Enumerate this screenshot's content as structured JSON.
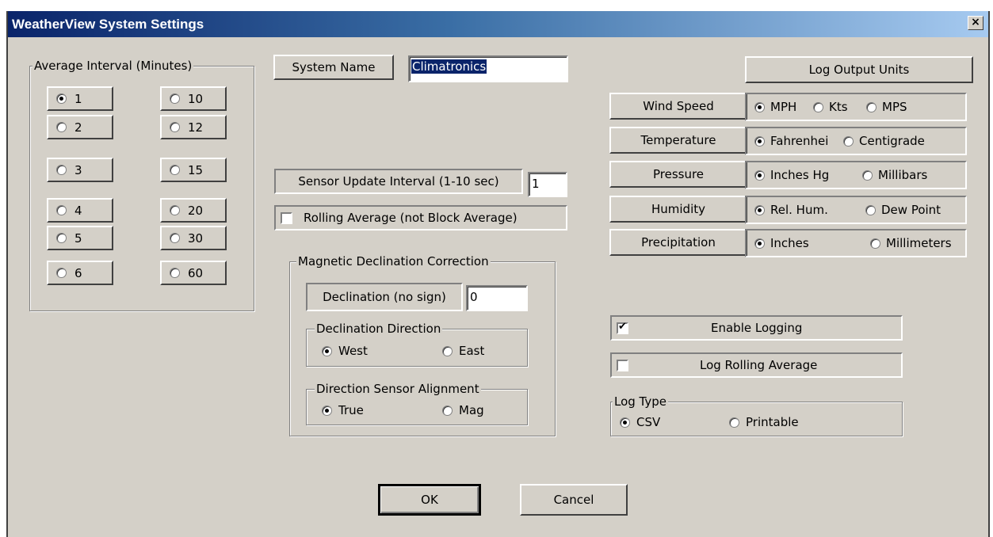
{
  "window": {
    "title": "WeatherView System Settings",
    "close": "×"
  },
  "avg_interval": {
    "legend": "Average Interval (Minutes)",
    "selected": "1",
    "options_left": [
      "1",
      "2",
      "3",
      "4",
      "5",
      "6"
    ],
    "options_right": [
      "10",
      "12",
      "15",
      "20",
      "30",
      "60"
    ]
  },
  "system_name": {
    "label": "System Name",
    "value": "Climatronics"
  },
  "sensor_update": {
    "label": "Sensor Update Interval (1-10 sec)",
    "value": "1"
  },
  "rolling_average": {
    "label": "Rolling Average (not Block Average)",
    "checked": false
  },
  "magnetic": {
    "legend": "Magnetic Declination Correction",
    "declination_label": "Declination (no sign)",
    "declination_value": "0",
    "direction": {
      "legend": "Declination Direction",
      "west": "West",
      "east": "East",
      "selected": "West"
    },
    "alignment": {
      "legend": "Direction Sensor Alignment",
      "true_label": "True",
      "mag": "Mag",
      "selected": "True"
    }
  },
  "log_units": {
    "header": "Log Output Units",
    "wind": {
      "label": "Wind Speed",
      "opt1": "MPH",
      "opt2": "Kts",
      "opt3": "MPS",
      "selected": "MPH"
    },
    "temperature": {
      "label": "Temperature",
      "opt1": "Fahrenhei",
      "opt2": "Centigrade",
      "selected": "Fahrenhei"
    },
    "pressure": {
      "label": "Pressure",
      "opt1": "Inches Hg",
      "opt2": "Millibars",
      "selected": "Inches Hg"
    },
    "humidity": {
      "label": "Humidity",
      "opt1": "Rel. Hum.",
      "opt2": "Dew Point",
      "selected": "Rel. Hum."
    },
    "precipitation": {
      "label": "Precipitation",
      "opt1": "Inches",
      "opt2": "Millimeters",
      "selected": "Inches"
    }
  },
  "logging": {
    "enable_label": "Enable Logging",
    "enable_checked": true,
    "rolling_label": "Log Rolling Average",
    "rolling_checked": false,
    "type_legend": "Log Type",
    "csv": "CSV",
    "printable": "Printable",
    "selected": "CSV"
  },
  "buttons": {
    "ok": "OK",
    "cancel": "Cancel"
  }
}
